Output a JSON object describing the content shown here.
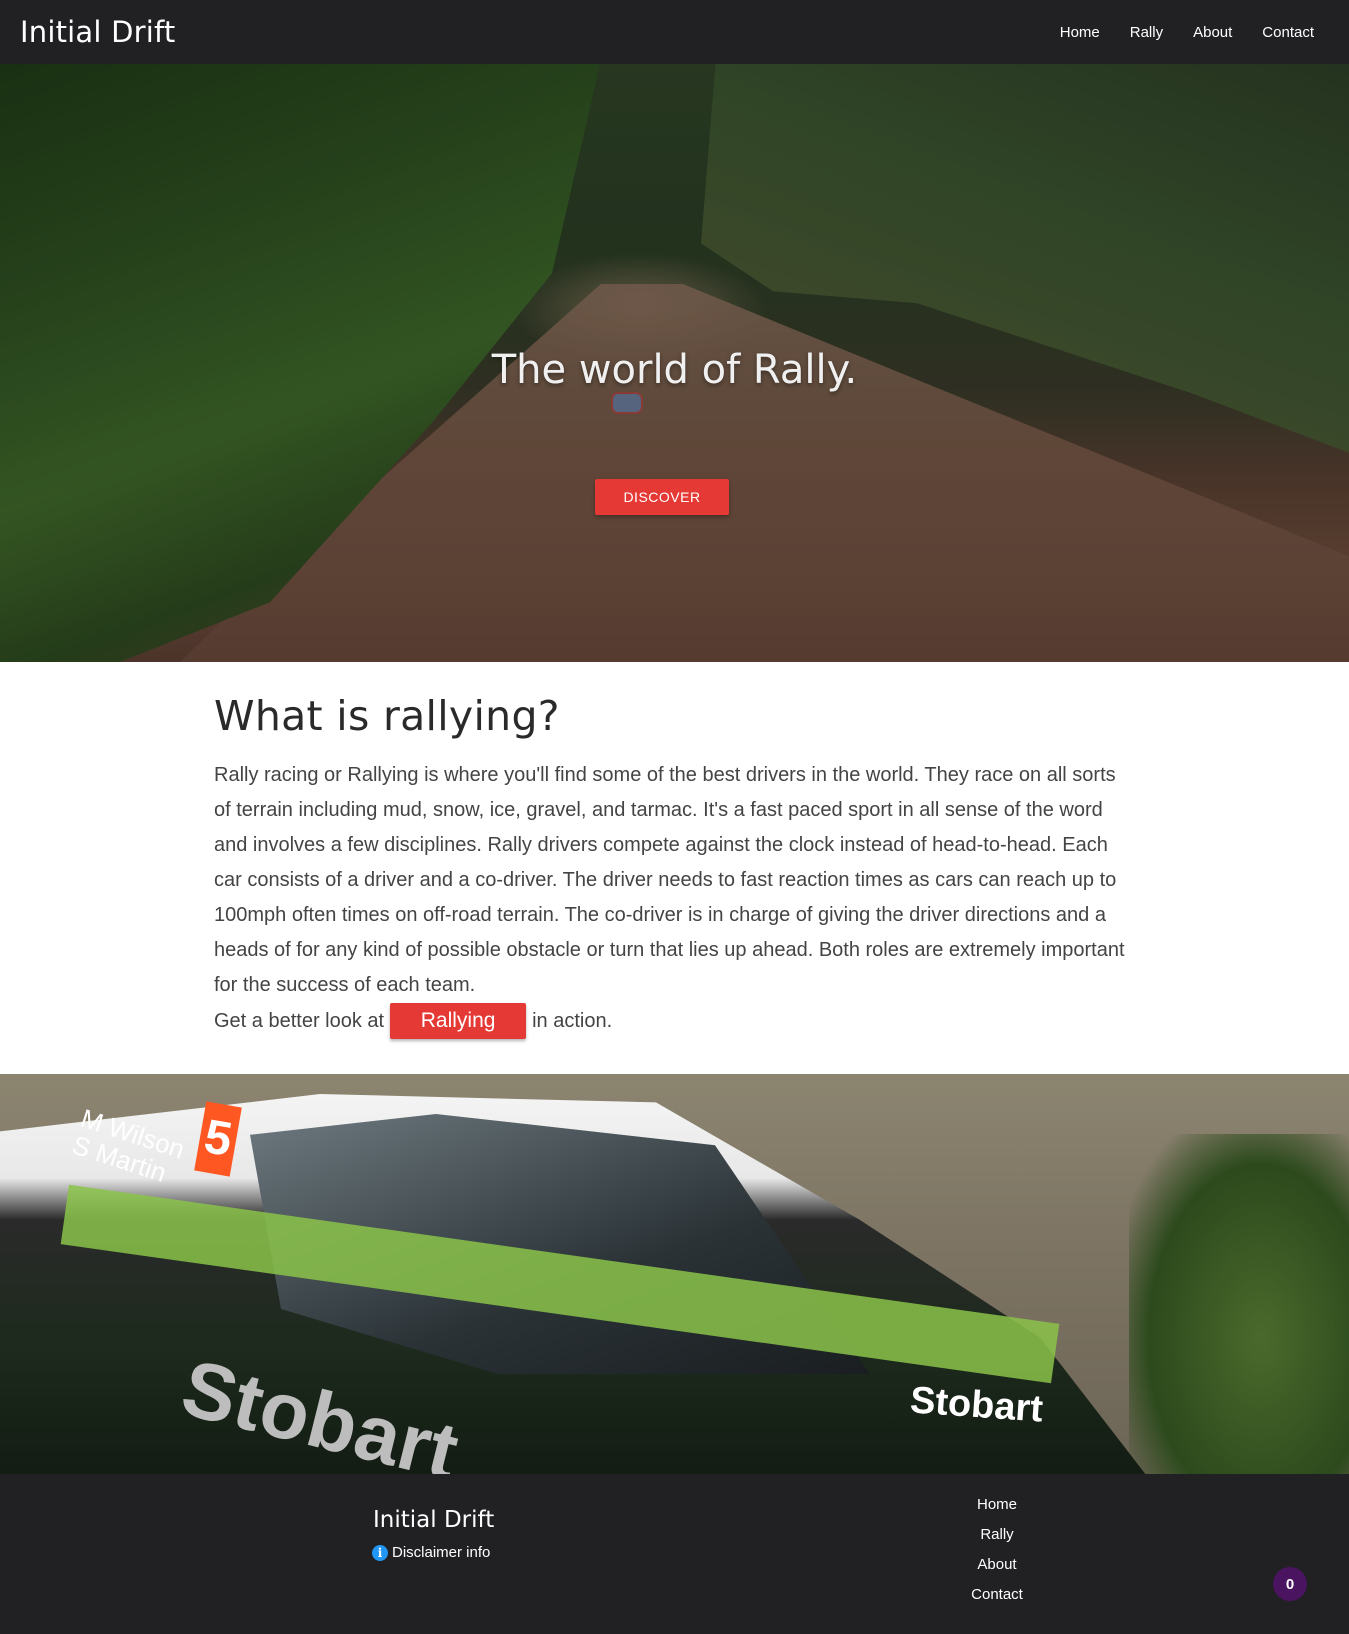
{
  "nav": {
    "brand": "Initial Drift",
    "links": [
      "Home",
      "Rally",
      "About",
      "Contact"
    ]
  },
  "hero": {
    "title": "The world of Rally.",
    "button": "DISCOVER"
  },
  "content": {
    "heading": "What is rallying?",
    "paragraph": "Rally racing or Rallying is where you'll find some of the best drivers in the world. They race on all sorts of terrain including mud, snow, ice, gravel, and tarmac. It's a fast paced sport in all sense of the word and involves a few disciplines. Rally drivers compete against the clock instead of head-to-head. Each car consists of a driver and a co-driver. The driver needs to fast reaction times as cars can reach up to 100mph often times on off-road terrain. The co-driver is in charge of giving the driver directions and a heads of for any kind of possible obstacle or turn that lies up ahead. Both roles are extremely important for the success of each team.",
    "cta_prefix": "Get a better look at",
    "cta_button": "Rallying",
    "cta_suffix": "in action."
  },
  "car_image": {
    "number": "5",
    "names": [
      "M Wilson",
      "S Martin"
    ],
    "sponsor": "Stobart"
  },
  "footer": {
    "brand": "Initial Drift",
    "disclaimer": "Disclaimer info",
    "links": [
      "Home",
      "Rally",
      "About",
      "Contact"
    ],
    "badge_count": "0"
  },
  "colors": {
    "nav_bg": "#212124",
    "accent": "#e53935",
    "badge": "#4a1460",
    "info": "#2196f3"
  },
  "icons": {
    "disclaimer": "info-icon"
  }
}
